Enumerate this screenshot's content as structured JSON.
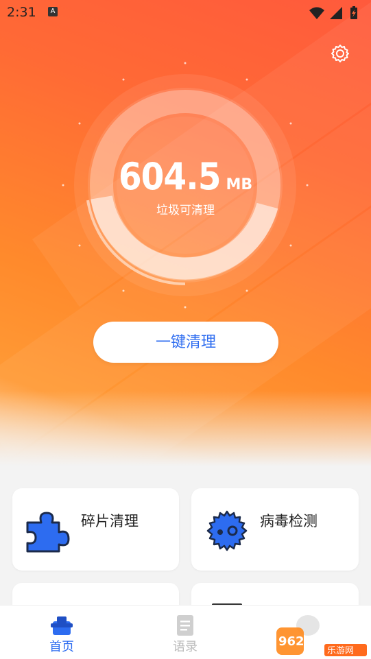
{
  "status_bar": {
    "time": "2:31",
    "notif_icon": "A"
  },
  "header": {
    "settings_icon": "gear-icon"
  },
  "junk": {
    "value": "604.5",
    "unit": "MB",
    "label": "垃圾可清理"
  },
  "primary_action": {
    "label": "一键清理"
  },
  "cards": [
    {
      "label": "碎片清理",
      "icon": "puzzle-icon"
    },
    {
      "label": "病毒检测",
      "icon": "gear-virus-icon"
    }
  ],
  "tabs": [
    {
      "label": "首页",
      "icon": "home-icon",
      "active": true
    },
    {
      "label": "语录",
      "icon": "document-icon",
      "active": false
    }
  ],
  "watermark": {
    "text": "962.NET",
    "sub": "乐游网"
  },
  "colors": {
    "accent": "#2d6cf0",
    "hero_top": "#ff5a3c",
    "hero_bottom": "#ff9a35"
  }
}
